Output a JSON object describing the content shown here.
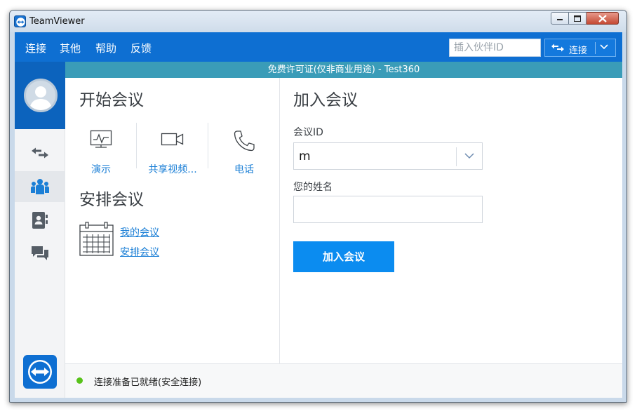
{
  "window": {
    "title": "TeamViewer"
  },
  "menubar": {
    "items": [
      "连接",
      "其他",
      "帮助",
      "反馈"
    ],
    "partner_id_placeholder": "插入伙伴ID",
    "connect_label": "连接"
  },
  "license": {
    "text": "免费许可证(仅非商业用途) - Test360"
  },
  "start_meeting": {
    "title": "开始会议",
    "tiles": [
      {
        "label": "演示",
        "icon": "presentation-icon"
      },
      {
        "label": "共享视频...",
        "icon": "video-camera-icon"
      },
      {
        "label": "电话",
        "icon": "phone-icon"
      }
    ]
  },
  "schedule_meeting": {
    "title": "安排会议",
    "links": [
      "我的会议",
      "安排会议"
    ]
  },
  "join_meeting": {
    "title": "加入会议",
    "meeting_id_label": "会议ID",
    "meeting_id_value": "m",
    "name_label": "您的姓名",
    "name_value": "",
    "join_button": "加入会议"
  },
  "status": {
    "text": "连接准备已就绪(安全连接)",
    "dot_color": "#58c21a"
  },
  "colors": {
    "menubar": "#0e6fd2",
    "license_bar": "#3a9cb8",
    "accent": "#1b7fd6",
    "join_button": "#0b8cf0"
  }
}
